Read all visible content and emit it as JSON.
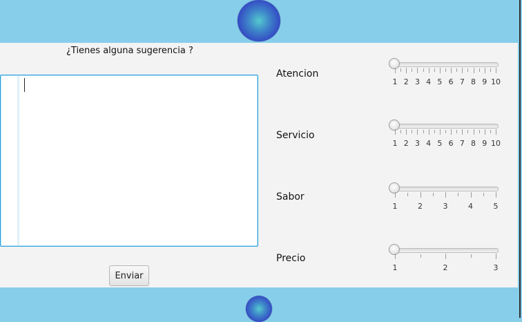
{
  "form": {
    "prompt": "¿Tienes alguna sugerencia ?",
    "textarea_value": "",
    "submit_label": "Enviar"
  },
  "ratings": [
    {
      "label": "Atencion",
      "min": 1,
      "max": 10,
      "value": 1,
      "tick_labels": [
        "1",
        "2",
        "3",
        "4",
        "5",
        "6",
        "7",
        "8",
        "9",
        "10"
      ]
    },
    {
      "label": "Servicio",
      "min": 1,
      "max": 10,
      "value": 1,
      "tick_labels": [
        "1",
        "2",
        "3",
        "4",
        "5",
        "6",
        "7",
        "8",
        "9",
        "10"
      ]
    },
    {
      "label": "Sabor",
      "min": 1,
      "max": 5,
      "value": 1,
      "tick_labels": [
        "1",
        "2",
        "3",
        "4",
        "5"
      ]
    },
    {
      "label": "Precio",
      "min": 1,
      "max": 3,
      "value": 1,
      "tick_labels": [
        "1",
        "2",
        "3"
      ]
    }
  ],
  "colors": {
    "band": "#87ceeb",
    "panel": "#f3f3f3",
    "focus_border": "#2aa0dc",
    "orb_center": "#55c9cf",
    "orb_edge": "#2a2faa"
  }
}
